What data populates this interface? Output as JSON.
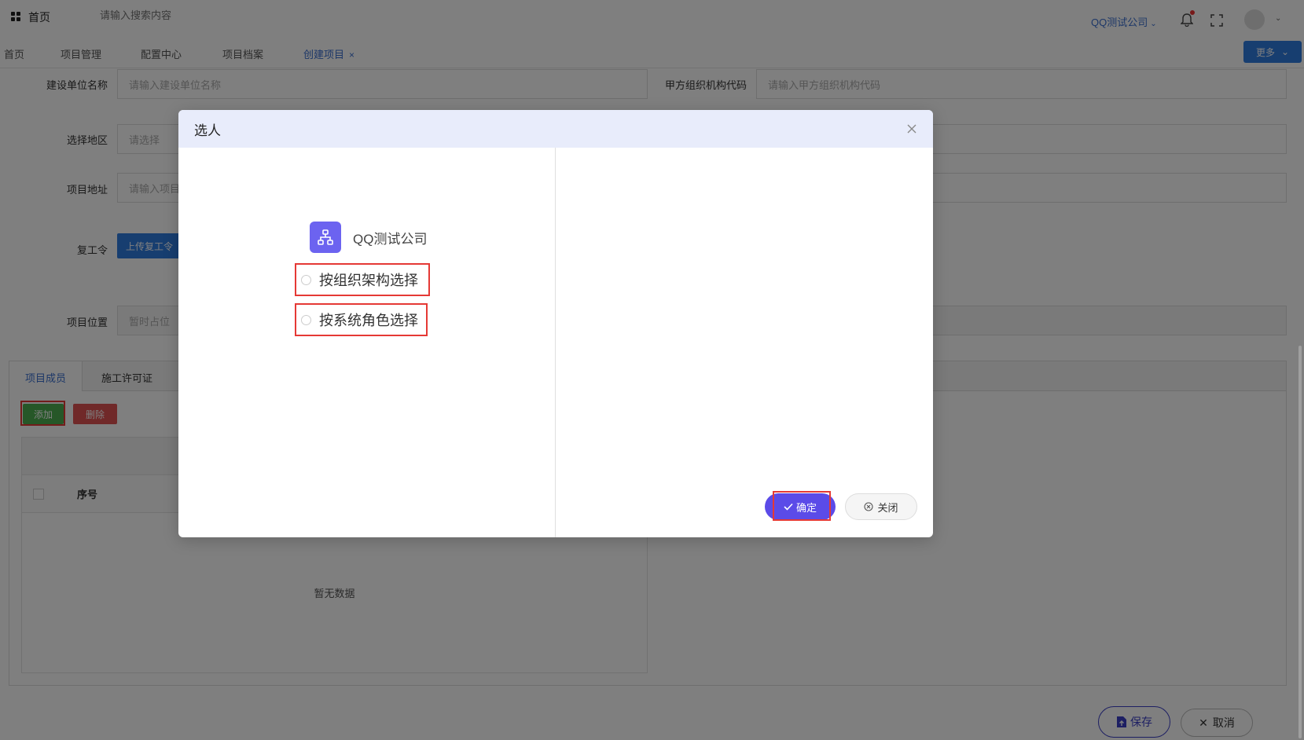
{
  "topbar": {
    "home_label": "首页",
    "search_placeholder": "请输入搜索内容",
    "company": "QQ测试公司"
  },
  "tabs": [
    {
      "label": "首页"
    },
    {
      "label": "项目管理"
    },
    {
      "label": "配置中心"
    },
    {
      "label": "项目档案"
    },
    {
      "label": "创建项目",
      "close": "×"
    }
  ],
  "more_label": "更多",
  "form": {
    "builder_label": "建设单位名称",
    "builder_placeholder": "请输入建设单位名称",
    "org_code_label": "甲方组织机构代码",
    "org_code_placeholder": "请输入甲方组织机构代码",
    "region_label": "选择地区",
    "region_placeholder": "请选择",
    "address_label": "项目地址",
    "address_placeholder": "请输入项目",
    "resume_label": "复工令",
    "upload_label": "上传复工令",
    "location_label": "项目位置",
    "location_placeholder": "暂时占位"
  },
  "panel": {
    "tab_members": "项目成员",
    "tab_permit": "施工许可证",
    "add_label": "添加",
    "delete_label": "删除",
    "seq_header": "序号",
    "empty_text": "暂无数据"
  },
  "footer": {
    "save_label": "保存",
    "cancel_label": "取消"
  },
  "modal": {
    "title": "选人",
    "org_name": "QQ测试公司",
    "option1": "按组织架构选择",
    "option2": "按系统角色选择",
    "ok_label": "确定",
    "close_label": "关闭"
  },
  "colors": {
    "primary": "#5b4be8",
    "highlight": "#e53935",
    "link": "#3a6fd0"
  }
}
